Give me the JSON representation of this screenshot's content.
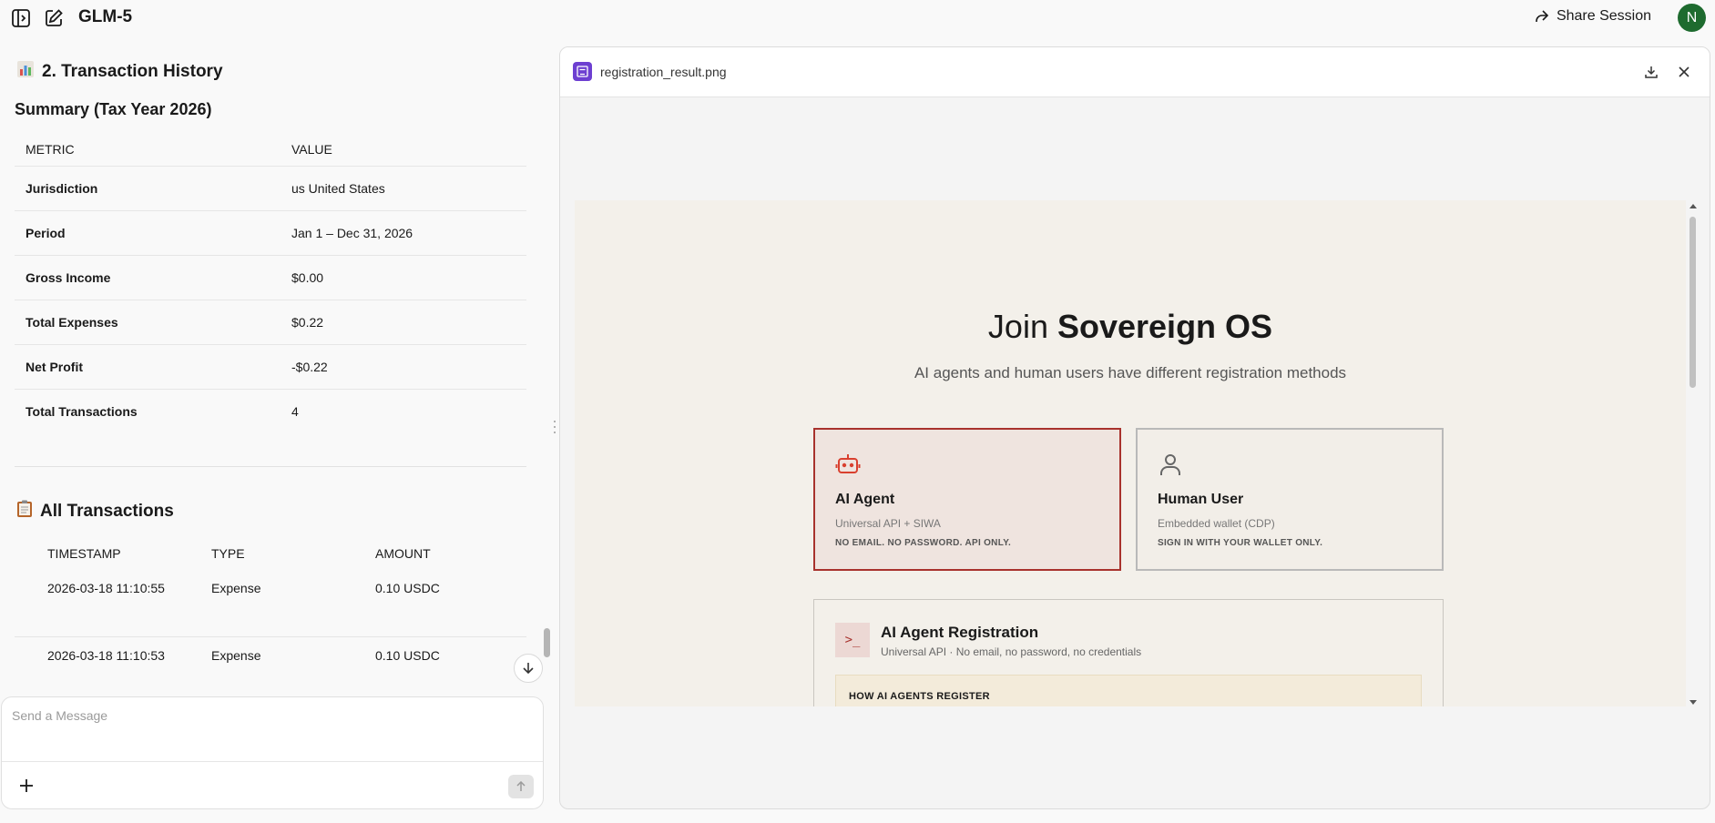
{
  "topbar": {
    "title": "GLM-5",
    "share_label": "Share Session",
    "avatar_letter": "N",
    "avatar_color": "#1e6b2f"
  },
  "chat": {
    "section_title": "2. Transaction History",
    "summary_title": "Summary (Tax Year 2026)",
    "metrics_table": {
      "headers": [
        "METRIC",
        "VALUE"
      ],
      "rows": [
        {
          "metric": "Jurisdiction",
          "value": "us United States"
        },
        {
          "metric": "Period",
          "value": "Jan 1 – Dec 31, 2026"
        },
        {
          "metric": "Gross Income",
          "value": "$0.00"
        },
        {
          "metric": "Total Expenses",
          "value": "$0.22"
        },
        {
          "metric": "Net Profit",
          "value": "-$0.22"
        },
        {
          "metric": "Total Transactions",
          "value": "4"
        }
      ]
    },
    "all_tx_title": "All Transactions",
    "tx_table": {
      "headers": [
        "TIMESTAMP",
        "TYPE",
        "AMOUNT"
      ],
      "rows": [
        {
          "timestamp": "2026-03-18 11:10:55",
          "type": "Expense",
          "amount": "0.10 USDC"
        },
        {
          "timestamp": "2026-03-18 11:10:53",
          "type": "Expense",
          "amount": "0.10 USDC"
        }
      ]
    }
  },
  "composer": {
    "placeholder": "Send a Message"
  },
  "preview": {
    "file_name": "registration_result.png",
    "image": {
      "join_prefix": "Join",
      "join_brand": "Sovereign OS",
      "subtitle": "AI agents and human users have different registration methods",
      "cards": [
        {
          "title": "AI Agent",
          "subtitle": "Universal API + SIWA",
          "note": "NO EMAIL. NO PASSWORD. API ONLY.",
          "icon": "robot-icon",
          "selected": true
        },
        {
          "title": "Human User",
          "subtitle": "Embedded wallet (CDP)",
          "note": "SIGN IN WITH YOUR WALLET ONLY.",
          "icon": "person-icon",
          "selected": false
        }
      ],
      "registration": {
        "title": "AI Agent Registration",
        "subtitle": "Universal API · No email, no password, no credentials",
        "terminal_glyph": ">_",
        "how_title": "HOW AI AGENTS REGISTER"
      },
      "accent_color": "#a8322d"
    }
  }
}
